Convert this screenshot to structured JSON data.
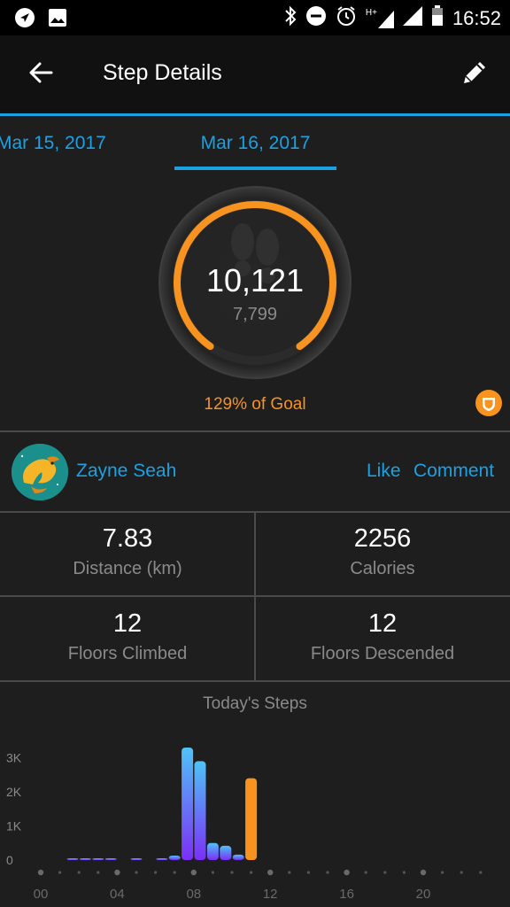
{
  "status_bar": {
    "time": "16:52",
    "left_icons": [
      "navigation-icon",
      "image-icon"
    ],
    "right_icons": [
      "bluetooth-icon",
      "do-not-disturb-icon",
      "alarm-icon",
      "hplus-signal-icon",
      "cell-signal-icon",
      "battery-icon"
    ],
    "network_label": "H+"
  },
  "header": {
    "title": "Step Details",
    "back_icon": "arrow-back-icon",
    "edit_icon": "pencil-icon"
  },
  "date_tabs": {
    "previous": "Mar 15, 2017",
    "current": "Mar 16, 2017"
  },
  "summary": {
    "steps": "10,121",
    "goal": "7,799",
    "percent_of_goal": "129% of Goal",
    "progress_fraction": 1.0,
    "badge_icon": "goal-badge-icon"
  },
  "user": {
    "name": "Zayne Seah",
    "like_label": "Like",
    "comment_label": "Comment"
  },
  "stats": [
    {
      "value": "7.83",
      "label": "Distance (km)"
    },
    {
      "value": "2256",
      "label": "Calories"
    },
    {
      "value": "12",
      "label": "Floors Climbed"
    },
    {
      "value": "12",
      "label": "Floors Descended"
    }
  ],
  "colors": {
    "accent_blue": "#1ba1e2",
    "goal_orange": "#f7931e",
    "bar_gradient_top": "#4fc3f7",
    "bar_gradient_bottom": "#7b2ff7",
    "goal_bar": "#f7931e",
    "background": "#1e1e1e"
  },
  "chart_data": {
    "type": "bar",
    "title": "Today's Steps",
    "ylim": [
      0,
      3300
    ],
    "y_ticks": [
      "0",
      "1K",
      "2K",
      "3K"
    ],
    "y_tick_values": [
      0,
      1000,
      2000,
      3000
    ],
    "x_tick_labels": [
      "00",
      "04",
      "08",
      "12",
      "16",
      "20"
    ],
    "x_tick_hours": [
      0,
      4,
      8,
      12,
      16,
      20
    ],
    "x": [
      1,
      2,
      3,
      4,
      6,
      8,
      9,
      10,
      11,
      12,
      13,
      14,
      15
    ],
    "values": [
      10,
      50,
      30,
      0,
      20,
      20,
      130,
      3300,
      2900,
      500,
      420,
      160,
      2400
    ],
    "goal_reached_index": 12
  }
}
